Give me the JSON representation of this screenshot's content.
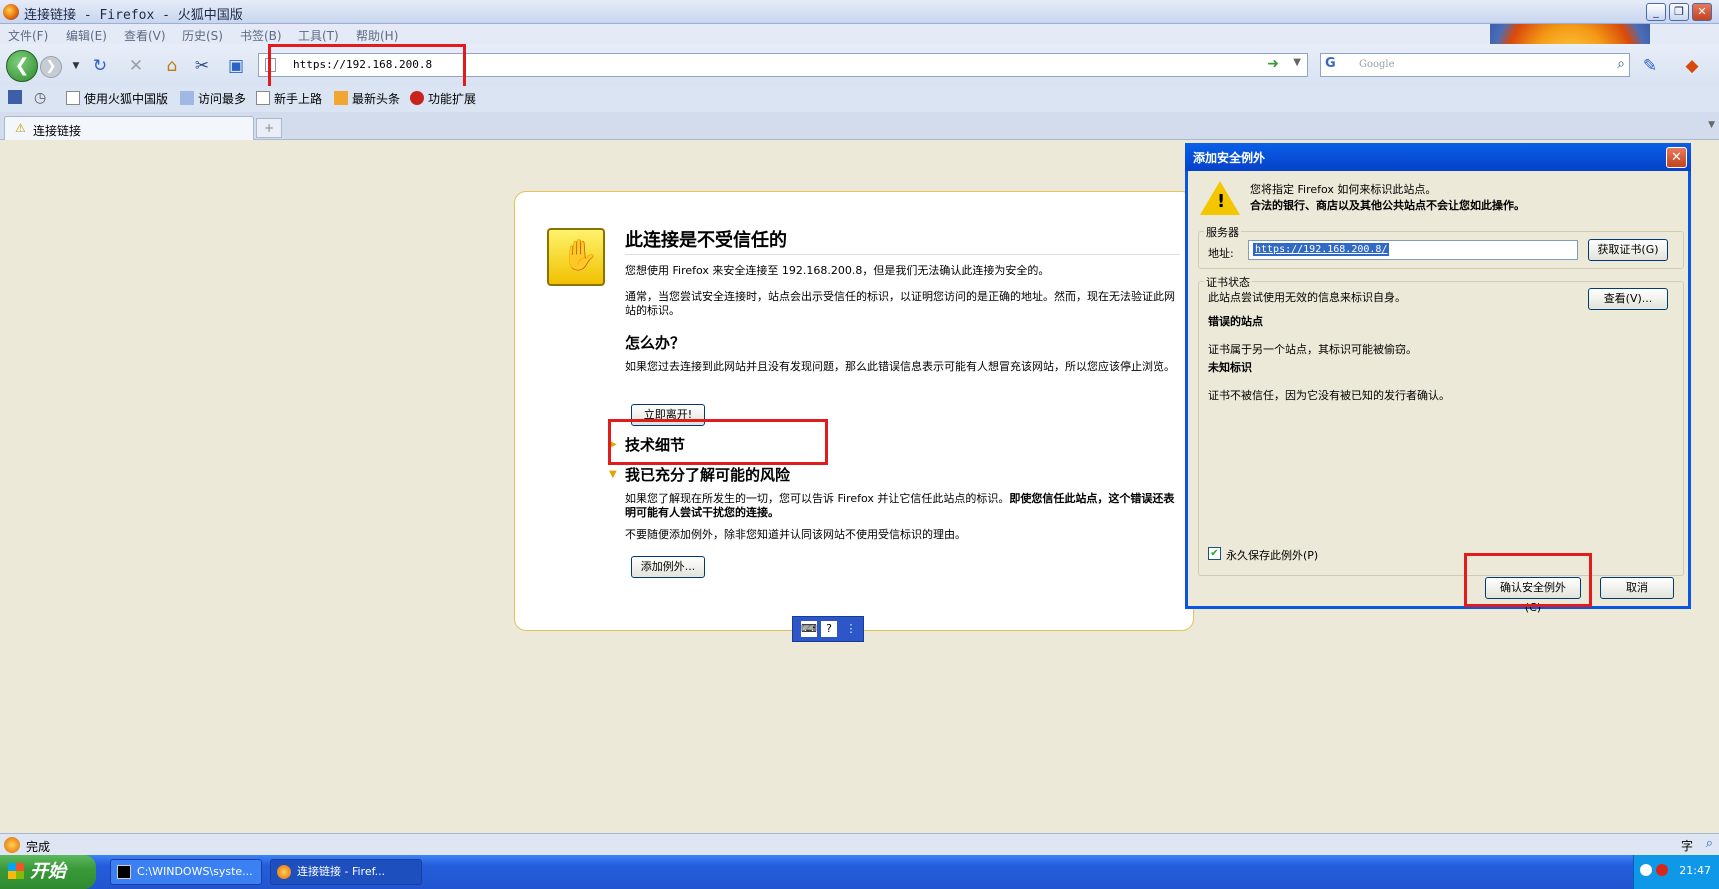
{
  "window": {
    "title": "连接链接 - Firefox - 火狐中国版"
  },
  "menu": [
    "文件(F)",
    "编辑(E)",
    "查看(V)",
    "历史(S)",
    "书签(B)",
    "工具(T)",
    "帮助(H)"
  ],
  "address": {
    "url": "https://192.168.200.8"
  },
  "search": {
    "placeholder": "Google"
  },
  "bookmarks": [
    "使用火狐中国版",
    "访问最多",
    "新手上路",
    "最新头条",
    "功能扩展"
  ],
  "tab": {
    "label": "连接链接"
  },
  "error": {
    "title": "此连接是不受信任的",
    "intro": "您想使用 Firefox 来安全连接至 192.168.200.8，但是我们无法确认此连接为安全的。",
    "normally": "通常，当您尝试安全连接时，站点会出示受信任的标识，以证明您访问的是正确的地址。然而，现在无法验证此网站的标识。",
    "what_heading": "怎么办？",
    "what_text": "如果您过去连接到此网站并且没有发现问题，那么此错误信息表示可能有人想冒充该网站，所以您应该停止浏览。",
    "leave_button": "立即离开!",
    "tech_heading": "技术细节",
    "risk_heading": "我已充分了解可能的风险",
    "risk_text_plain": "如果您了解现在所发生的一切，您可以告诉 Firefox 并让它信任此站点的标识。",
    "risk_text_bold": "即使您信任此站点，这个错误还表明可能有人尝试干扰您的连接。",
    "no_add_text": "不要随便添加例外，除非您知道并认同该网站不使用受信标识的理由。",
    "add_exception_button": "添加例外..."
  },
  "dialog": {
    "title": "添加安全例外",
    "line1": "您将指定 Firefox 如何来标识此站点。",
    "line2": "合法的银行、商店以及其他公共站点不会让您如此操作。",
    "server_group": "服务器",
    "addr_label": "地址:",
    "addr_value": "https://192.168.200.8/",
    "get_cert_button": "获取证书(G)",
    "cert_group": "证书状态",
    "cert_text": "此站点尝试使用无效的信息来标识自身。",
    "view_button": "查看(V)...",
    "wrong_site_heading": "错误的站点",
    "wrong_site_text": "证书属于另一个站点，其标识可能被偷窃。",
    "unknown_heading": "未知标识",
    "unknown_text": "证书不被信任，因为它没有被已知的发行者确认。",
    "permanent_label": "永久保存此例外(P)",
    "permanent_checked": true,
    "confirm_button": "确认安全例外(C)",
    "cancel_button": "取消"
  },
  "status": {
    "text": "完成"
  },
  "taskbar": {
    "start": "开始",
    "tasks": [
      "C:\\WINDOWS\\syste...",
      "连接链接 - Firef..."
    ],
    "clock": "21:47"
  }
}
